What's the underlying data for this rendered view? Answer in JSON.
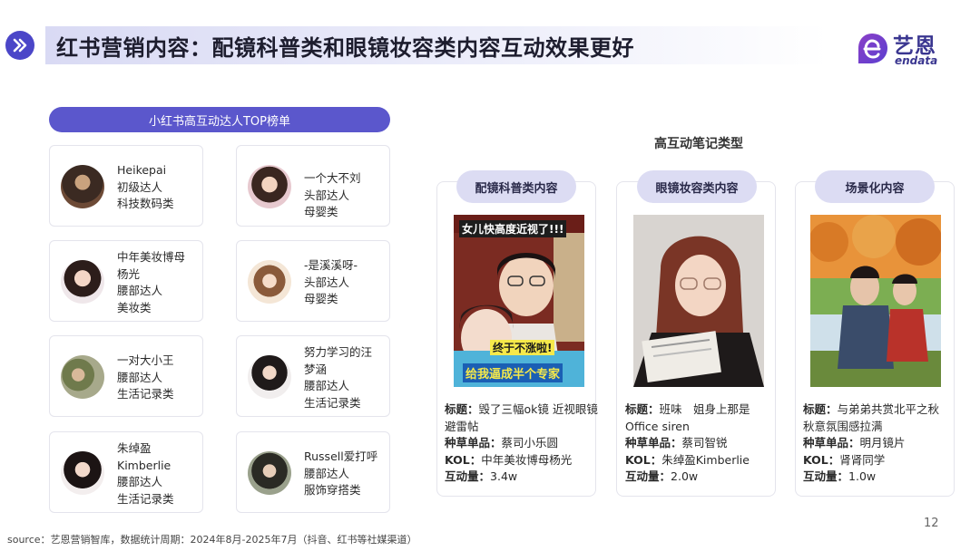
{
  "header": {
    "title": "红书营销内容：配镜科普类和眼镜妆容类内容互动效果更好",
    "logo_cn": "艺恩",
    "logo_en": "endata",
    "accent": "#4b46c8"
  },
  "ranking": {
    "title": "小红书高互动达人TOP榜单",
    "items": [
      {
        "lines": [
          "Heikepai",
          "初级达人",
          "科技数码类"
        ]
      },
      {
        "lines": [
          "一个大不刘",
          "头部达人",
          "母婴类"
        ]
      },
      {
        "lines": [
          "中年美妆博母",
          "杨光",
          "腰部达人",
          "美妆类"
        ]
      },
      {
        "lines": [
          "-是溪溪呀-",
          "头部达人",
          "母婴类"
        ]
      },
      {
        "lines": [
          "一对大小王",
          "腰部达人",
          "生活记录类"
        ]
      },
      {
        "lines": [
          "努力学习的汪",
          "梦涵",
          "腰部达人",
          "生活记录类"
        ]
      },
      {
        "lines": [
          "朱绰盈",
          "Kimberlie",
          "腰部达人",
          "生活记录类"
        ]
      },
      {
        "lines": [
          "Russell爱打呼",
          "腰部达人",
          "服饰穿搭类"
        ]
      }
    ]
  },
  "note_types": {
    "title": "高互动笔记类型",
    "cards": [
      {
        "label": "配镜科普类内容",
        "thumb_caption": "女儿快高度近视了!!!",
        "thumb_caption2": "终于不涨啦!",
        "thumb_caption3": "给我逼成半个专家",
        "title_label": "标题：",
        "title": "毁了三幅ok镜 近视眼镜避雷帖",
        "product_label": "种草单品：",
        "product": "蔡司小乐圆",
        "kol_label": "KOL：",
        "kol": "中年美妆博母杨光",
        "interact_label": "互动量：",
        "interact": "3.4w"
      },
      {
        "label": "眼镜妆容类内容",
        "title_label": "标题：",
        "title": "班味　姐身上那是Office siren",
        "product_label": "种草单品：",
        "product": "蔡司智锐",
        "kol_label": "KOL：",
        "kol": "朱绰盈Kimberlie",
        "interact_label": "互动量：",
        "interact": "2.0w"
      },
      {
        "label": "场景化内容",
        "title_label": "标题：",
        "title": "与弟弟共赏北平之秋　秋意氛围感拉满",
        "product_label": "种草单品：",
        "product": "明月镜片",
        "kol_label": "KOL：",
        "kol": "肾肾同学",
        "interact_label": "互动量：",
        "interact": "1.0w"
      }
    ]
  },
  "page_number": "12",
  "footer": "source：艺恩营销智库，数据统计周期：2024年8月-2025年7月（抖音、红书等社媒渠道）"
}
